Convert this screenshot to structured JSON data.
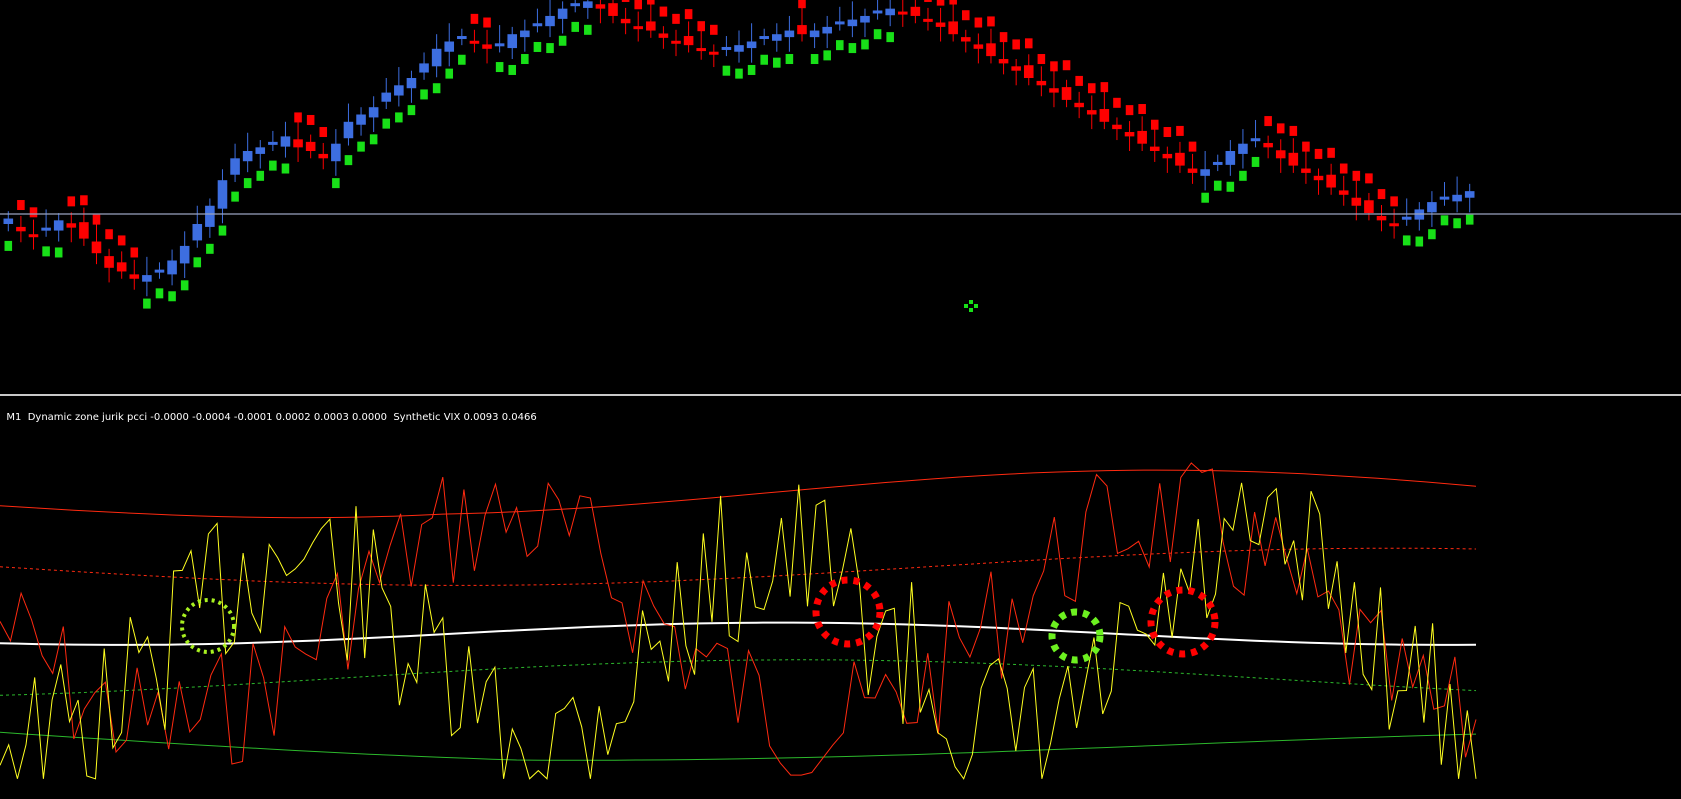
{
  "indicator_header": {
    "prefix": "M1",
    "label": "Dynamic zone jurik pcci -0.0000 -0.0004 -0.0001 0.0002 0.0003 0.0000  Synthetic VIX 0.0093 0.0466"
  },
  "colors": {
    "background": "#000000",
    "candle_bull": "#3d6ee0",
    "candle_bear": "#ff0000",
    "trail_bull": "#18e018",
    "trail_bear": "#ff0000",
    "pcci": "#ff2a10",
    "vix": "#ffff20",
    "midline": "#ffffff",
    "zone_upper": "#ff2a10",
    "zone_lower": "#2cb82c",
    "hline": "#9aa4c0"
  },
  "chart_data": [
    {
      "type": "candlestick",
      "title": "",
      "note": "price chart with trailing stop dots; y values in chart units 0-100",
      "closes": [
        40,
        38,
        37,
        39,
        41,
        39,
        36,
        32,
        28,
        27,
        25,
        26,
        27,
        30,
        34,
        40,
        45,
        52,
        58,
        60,
        61,
        62,
        64,
        61,
        60,
        58,
        62,
        68,
        70,
        72,
        76,
        78,
        80,
        84,
        88,
        90,
        91,
        90,
        88,
        89,
        92,
        93,
        95,
        97,
        99,
        100,
        101,
        99,
        97,
        95,
        94,
        93,
        91,
        90,
        89,
        88,
        87,
        88,
        89,
        90,
        91,
        92,
        93,
        92,
        93,
        94,
        95,
        96,
        97,
        98,
        99,
        98,
        97,
        96,
        94,
        92,
        90,
        88,
        86,
        84,
        82,
        80,
        78,
        76,
        74,
        72,
        70,
        68,
        66,
        64,
        62,
        60,
        58,
        56,
        54,
        55,
        57,
        60,
        62,
        63,
        61,
        58,
        56,
        54,
        52,
        50,
        48,
        45,
        43,
        41,
        40,
        42,
        44,
        46,
        47,
        48,
        49
      ]
    },
    {
      "type": "line",
      "title": "",
      "series": [
        {
          "name": "Dynamic zone jurik pcci",
          "color": "#ff2a10"
        },
        {
          "name": "Synthetic VIX",
          "color": "#ffff20"
        }
      ]
    }
  ],
  "annotations": [
    {
      "shape": "dotted-circle",
      "color": "#a8f020",
      "label": ""
    },
    {
      "shape": "dotted-circle",
      "color": "#ff0000",
      "label": ""
    },
    {
      "shape": "dotted-circle",
      "color": "#6cf020",
      "label": ""
    },
    {
      "shape": "dotted-circle",
      "color": "#ff0000",
      "label": ""
    }
  ]
}
